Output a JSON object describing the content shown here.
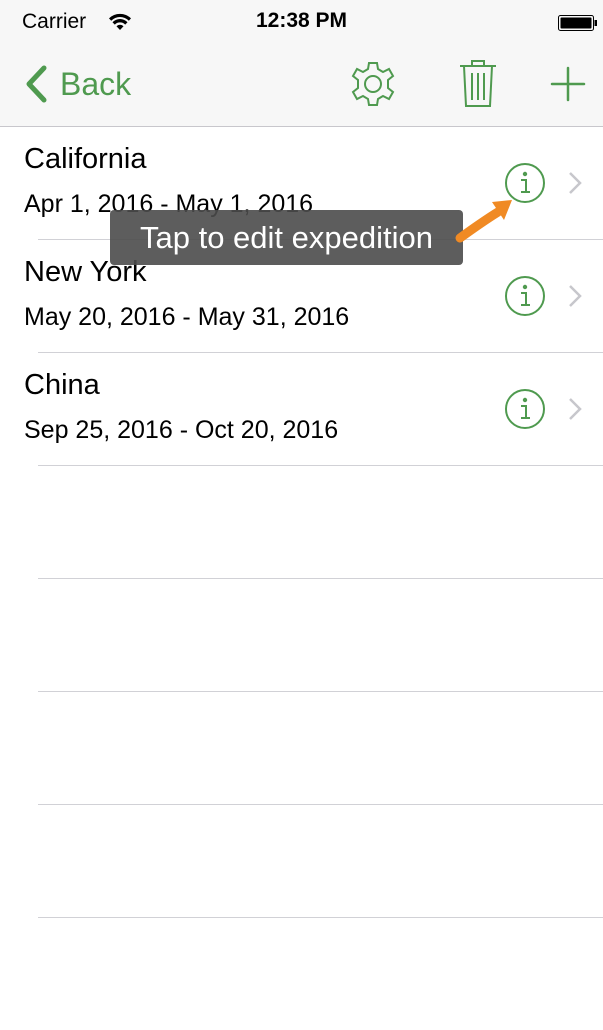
{
  "status_bar": {
    "carrier": "Carrier",
    "time": "12:38 PM",
    "icons": [
      "wifi-icon",
      "battery-icon"
    ]
  },
  "nav": {
    "back_label": "Back",
    "tint_color": "#4f9a4f",
    "icons": [
      "chevron-left-icon",
      "gear-icon",
      "trash-icon",
      "plus-icon"
    ]
  },
  "tooltip": {
    "text": "Tap to edit expedition",
    "arrow_color": "#f08a24"
  },
  "expeditions": [
    {
      "name": "California",
      "dates": "Apr 1, 2016 - May 1, 2016"
    },
    {
      "name": "New York",
      "dates": "May 20, 2016 - May 31, 2016"
    },
    {
      "name": "China",
      "dates": "Sep 25, 2016 - Oct 20, 2016"
    }
  ]
}
